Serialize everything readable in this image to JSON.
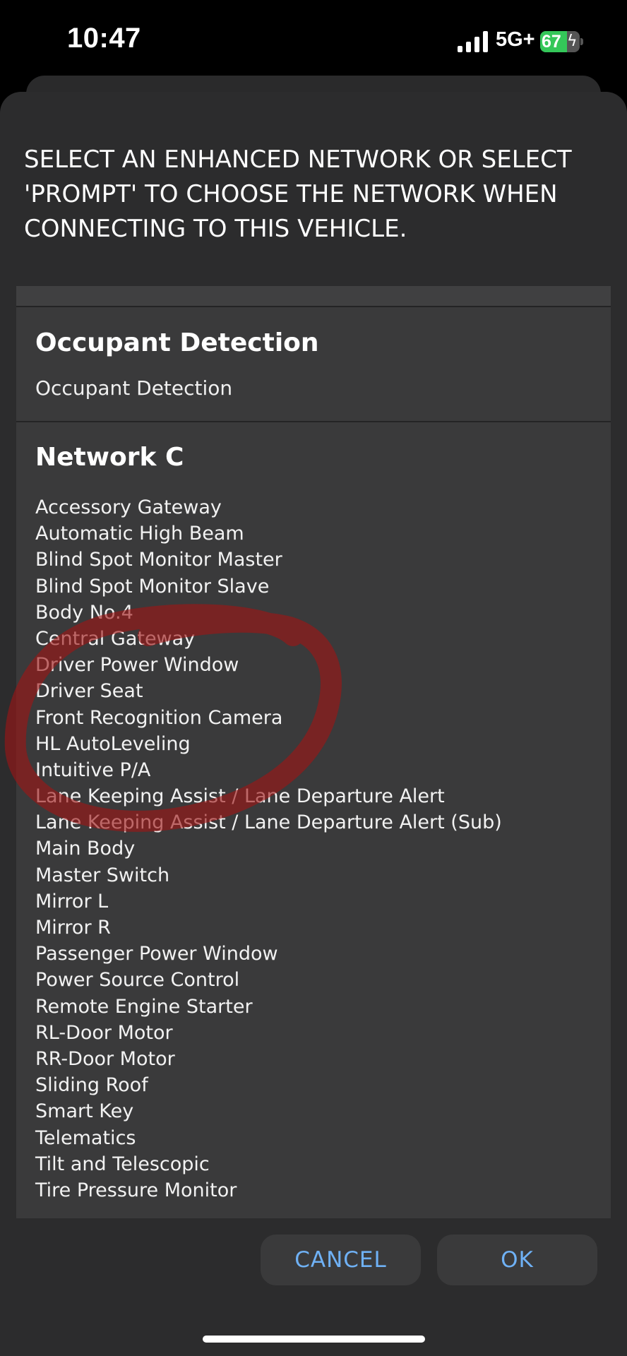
{
  "status_bar": {
    "time": "10:47",
    "network_type": "5G+",
    "battery_level": "67",
    "battery_fraction": 0.67,
    "icons": [
      "signal-bars-icon",
      "charging-bolt-icon"
    ],
    "battery_color": "#34c759"
  },
  "dialog": {
    "title": "SELECT AN ENHANCED NETWORK OR SELECT 'PROMPT' TO CHOOSE THE NETWORK WHEN CONNECTING TO THIS VEHICLE.",
    "groups": [
      {
        "title": "Occupant Detection",
        "subtitle": "Occupant Detection"
      },
      {
        "title": "Network C",
        "items": [
          "Accessory Gateway",
          "Automatic High Beam",
          "Blind Spot Monitor Master",
          "Blind Spot Monitor Slave",
          "Body No.4",
          "Central Gateway",
          "Driver Power Window",
          "Driver Seat",
          "Front Recognition Camera",
          "HL AutoLeveling",
          "Intuitive P/A",
          "Lane Keeping Assist / Lane Departure Alert",
          "Lane Keeping Assist / Lane Departure Alert (Sub)",
          "Main Body",
          "Master Switch",
          "Mirror L",
          "Mirror R",
          "Passenger Power Window",
          "Power Source Control",
          "Remote Engine Starter",
          "RL-Door Motor",
          "RR-Door Motor",
          "Sliding Roof",
          "Smart Key",
          "Telematics",
          "Tilt and Telescopic",
          "Tire Pressure Monitor"
        ]
      }
    ],
    "cancel_label": "CANCEL",
    "ok_label": "OK",
    "accent_color": "#6fb1f5",
    "annotation_color": "#9e1515"
  }
}
